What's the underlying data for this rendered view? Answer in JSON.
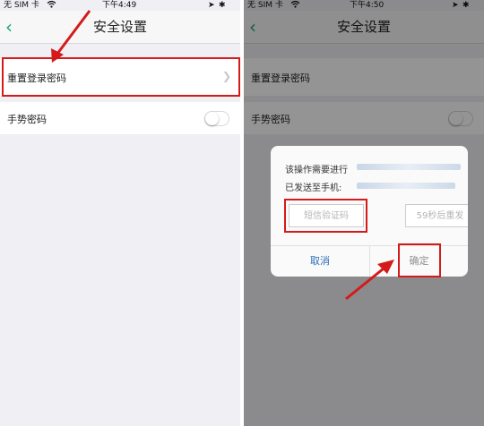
{
  "left": {
    "status": {
      "carrier": "无 SIM 卡",
      "wifi": "wifi-icon",
      "time": "下午4:49"
    },
    "nav": {
      "back": "back-icon",
      "title": "安全设置"
    },
    "rows": [
      {
        "label": "重置登录密码",
        "accessory": "chevron-right-icon"
      },
      {
        "label": "手势密码",
        "accessory": "toggle-switch"
      }
    ]
  },
  "right": {
    "status": {
      "carrier": "无 SIM 卡",
      "wifi": "wifi-icon",
      "time": "下午4:50"
    },
    "nav": {
      "back": "back-icon",
      "title": "安全设置"
    },
    "rows": [
      {
        "label": "重置登录密码"
      },
      {
        "label": "手势密码"
      }
    ],
    "dialog": {
      "line1": "该操作需要进行",
      "line2": "已发送至手机:",
      "code_placeholder": "短信验证码",
      "resend_label": "59秒后重发",
      "cancel_label": "取消",
      "confirm_label": "确定"
    }
  },
  "colors": {
    "highlight": "#d41a1a",
    "accent": "#1aa86a",
    "link": "#2f6fba"
  }
}
